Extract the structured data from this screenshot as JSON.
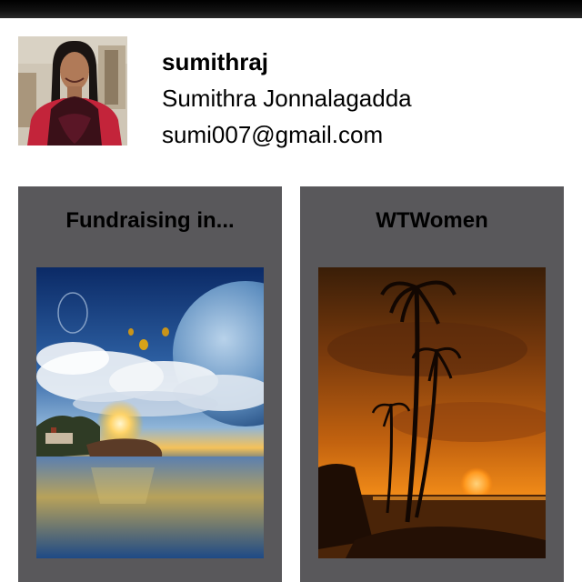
{
  "profile": {
    "username": "sumithraj",
    "full_name": "Sumithra Jonnalagadda",
    "email": "sumi007@gmail.com",
    "avatar": "profile-photo"
  },
  "cards": [
    {
      "title": "Fundraising in...",
      "image": "fantasy-sunset-planet-balloons"
    },
    {
      "title": "WTWomen",
      "image": "palm-tree-sunset"
    }
  ],
  "colors": {
    "status_bar": "#000000",
    "card_background": "#59585b",
    "page_background": "#ffffff"
  }
}
